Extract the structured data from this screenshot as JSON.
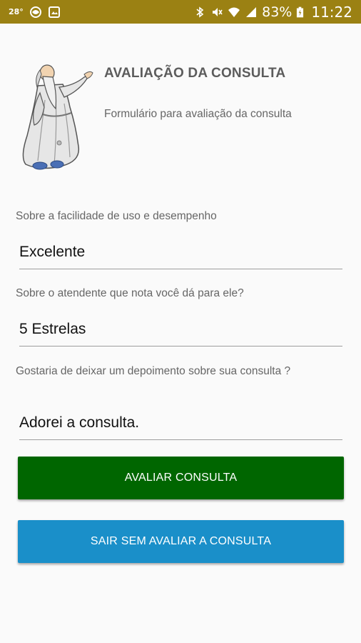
{
  "status_bar": {
    "temperature": "28°",
    "battery": "83%",
    "time": "11:22",
    "icons": [
      "weather-icon",
      "gallery-icon",
      "bluetooth-icon",
      "mute-icon",
      "wifi-icon",
      "signal-icon",
      "battery-icon"
    ]
  },
  "header": {
    "title": "AVALIAÇÃO DA CONSULTA",
    "subtitle": "Formulário para avaliação da consulta"
  },
  "form": {
    "ease_label": "Sobre a facilidade de uso e desempenho",
    "ease_value": "Excelente",
    "attendant_label": "Sobre o atendente que nota você dá para ele?",
    "attendant_value": "5 Estrelas",
    "testimonial_label": "Gostaria de deixar um depoimento sobre sua consulta ?",
    "testimonial_value": "Adorei a consulta."
  },
  "buttons": {
    "submit_label": "AVALIAR CONSULTA",
    "exit_label": "SAIR SEM AVALIAR A CONSULTA"
  },
  "colors": {
    "status_bar": "#9b8113",
    "submit_button": "#006600",
    "exit_button": "#1a8fc9"
  }
}
